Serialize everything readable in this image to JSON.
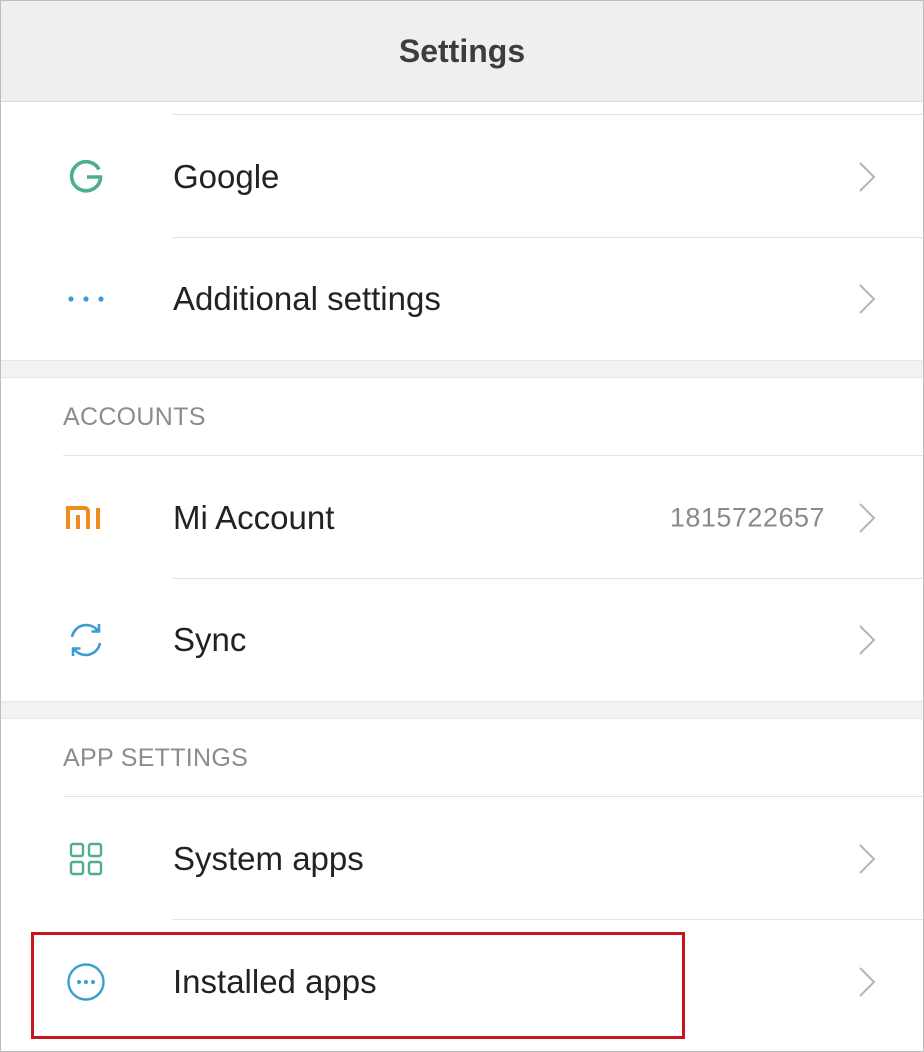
{
  "header": {
    "title": "Settings"
  },
  "colors": {
    "google_icon": "#4eae8f",
    "dots_icon": "#3a9fd0",
    "mi_icon": "#f08c1e",
    "sync_icon": "#3a9fd0",
    "system_apps_icon": "#4eae8f",
    "installed_apps_icon": "#3a9fd0",
    "highlight_border": "#c8141c"
  },
  "rows_top": [
    {
      "icon": "google-g-icon",
      "label": "Google"
    },
    {
      "icon": "more-dots-icon",
      "label": "Additional settings"
    }
  ],
  "accounts": {
    "header": "ACCOUNTS",
    "items": [
      {
        "icon": "mi-logo-icon",
        "label": "Mi Account",
        "value": "1815722657"
      },
      {
        "icon": "sync-icon",
        "label": "Sync"
      }
    ]
  },
  "app_settings": {
    "header": "APP SETTINGS",
    "items": [
      {
        "icon": "grid-apps-icon",
        "label": "System apps"
      },
      {
        "icon": "circle-dots-icon",
        "label": "Installed apps",
        "highlighted": true
      }
    ]
  }
}
